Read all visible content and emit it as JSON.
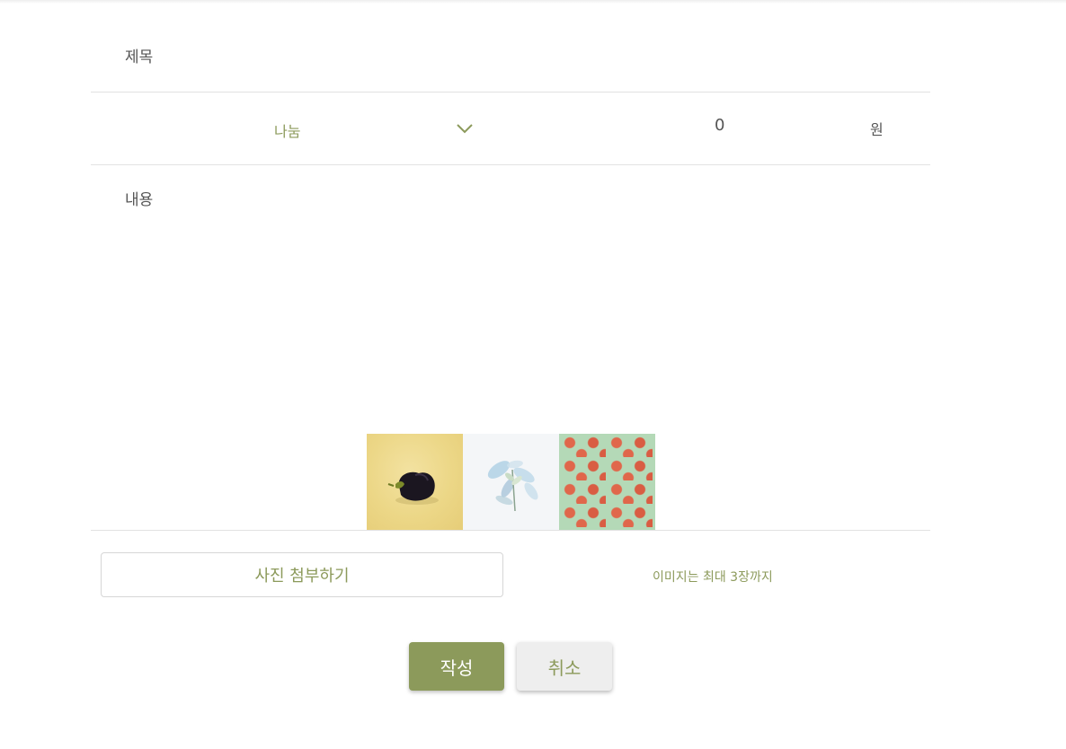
{
  "form": {
    "title_placeholder": "제목",
    "category": {
      "selected": "나눔"
    },
    "price": {
      "value": "0",
      "unit": "원"
    },
    "content_placeholder": "내용",
    "images": [
      {
        "label": "eggplant-photo"
      },
      {
        "label": "leaves-photo"
      },
      {
        "label": "tomato-pattern-photo"
      }
    ],
    "attach_label": "사진 첨부하기",
    "image_limit_note": "이미지는 최대 3장까지"
  },
  "actions": {
    "submit_label": "작성",
    "cancel_label": "취소"
  },
  "colors": {
    "accent": "#8c9a5b",
    "divider": "#e2e2e2",
    "cancel_bg": "#eeeeee"
  }
}
